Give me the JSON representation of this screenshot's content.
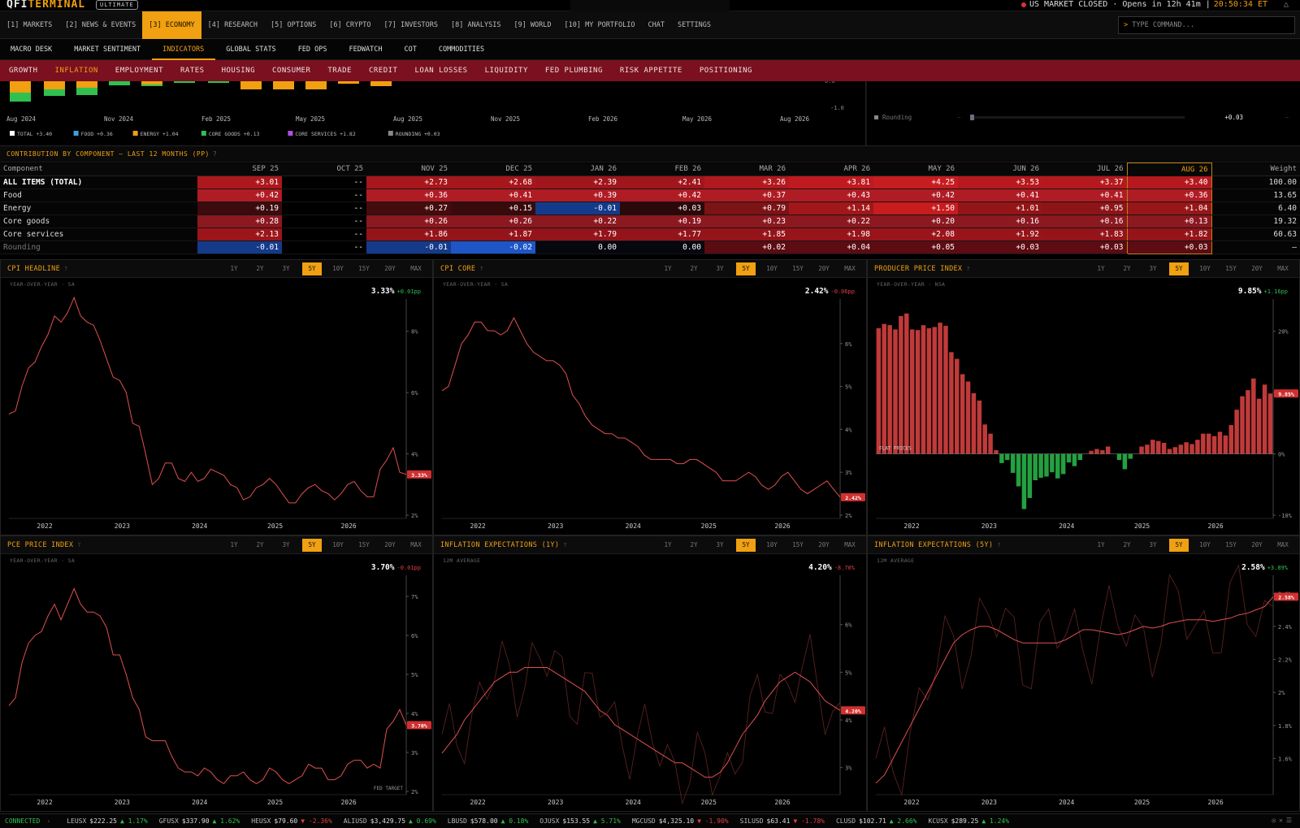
{
  "app": {
    "brand_a": "QFI",
    "brand_b": "TERMINAL",
    "badge": "ULTIMATE"
  },
  "market_status": {
    "text": "US MARKET CLOSED · Opens in 12h 41m |",
    "time": "20:50:34 ET"
  },
  "nav_main": [
    {
      "label": "[1] MARKETS",
      "active": false
    },
    {
      "label": "[2] NEWS & EVENTS",
      "active": false
    },
    {
      "label": "[3] ECONOMY",
      "active": true
    },
    {
      "label": "[4] RESEARCH",
      "active": false
    },
    {
      "label": "[5] OPTIONS",
      "active": false
    },
    {
      "label": "[6] CRYPTO",
      "active": false
    },
    {
      "label": "[7] INVESTORS",
      "active": false
    },
    {
      "label": "[8] ANALYSIS",
      "active": false
    },
    {
      "label": "[9] WORLD",
      "active": false
    },
    {
      "label": "[10] MY PORTFOLIO",
      "active": false
    },
    {
      "label": "CHAT",
      "active": false
    },
    {
      "label": "SETTINGS",
      "active": false
    }
  ],
  "command": {
    "prompt": ">",
    "placeholder": "TYPE COMMAND..."
  },
  "nav_sub": [
    {
      "label": "MACRO DESK",
      "active": false
    },
    {
      "label": "MARKET SENTIMENT",
      "active": false
    },
    {
      "label": "INDICATORS",
      "active": true
    },
    {
      "label": "GLOBAL STATS",
      "active": false
    },
    {
      "label": "FED OPS",
      "active": false
    },
    {
      "label": "FEDWATCH",
      "active": false
    },
    {
      "label": "COT",
      "active": false
    },
    {
      "label": "COMMODITIES",
      "active": false
    }
  ],
  "nav_cat": [
    {
      "label": "GROWTH",
      "active": false
    },
    {
      "label": "INFLATION",
      "active": true
    },
    {
      "label": "EMPLOYMENT",
      "active": false
    },
    {
      "label": "RATES",
      "active": false
    },
    {
      "label": "HOUSING",
      "active": false
    },
    {
      "label": "CONSUMER",
      "active": false
    },
    {
      "label": "TRADE",
      "active": false
    },
    {
      "label": "CREDIT",
      "active": false
    },
    {
      "label": "LOAN LOSSES",
      "active": false
    },
    {
      "label": "LIQUIDITY",
      "active": false
    },
    {
      "label": "FED PLUMBING",
      "active": false
    },
    {
      "label": "RISK APPETITE",
      "active": false
    },
    {
      "label": "POSITIONING",
      "active": false
    }
  ],
  "stack_chart": {
    "x_labels": [
      "Aug 2024",
      "Nov 2024",
      "Feb 2025",
      "May 2025",
      "Aug 2025",
      "Nov 2025",
      "Feb 2026",
      "May 2026",
      "Aug 2026"
    ],
    "y_labels": [
      "0.0",
      "-1.0"
    ],
    "legend": [
      {
        "label": "TOTAL +3.40",
        "color": "#ffffff"
      },
      {
        "label": "FOOD +0.36",
        "color": "#3aa0e0"
      },
      {
        "label": "ENERGY +1.04",
        "color": "#f0a010"
      },
      {
        "label": "CORE GOODS +0.13",
        "color": "#30c050"
      },
      {
        "label": "CORE SERVICES +1.82",
        "color": "#b050e0"
      },
      {
        "label": "ROUNDING +0.03",
        "color": "#888888"
      }
    ]
  },
  "right_mini": {
    "label": "Rounding",
    "dash": "—",
    "value": "+0.03",
    "dash2": "—"
  },
  "contrib": {
    "title": "CONTRIBUTION BY COMPONENT — LAST 12 MONTHS (PP)",
    "help": "?",
    "headers": [
      "Component",
      "SEP 25",
      "OCT 25",
      "NOV 25",
      "DEC 25",
      "JAN 26",
      "FEB 26",
      "MAR 26",
      "APR 26",
      "MAY 26",
      "JUN 26",
      "JUL 26",
      "AUG 26",
      "Weight"
    ],
    "rows": [
      {
        "name": "ALL ITEMS (TOTAL)",
        "vals": [
          "+3.01",
          "--",
          "+2.73",
          "+2.68",
          "+2.39",
          "+2.41",
          "+3.26",
          "+3.81",
          "+4.25",
          "+3.53",
          "+3.37",
          "+3.40"
        ],
        "weight": "100.00"
      },
      {
        "name": "Food",
        "vals": [
          "+0.42",
          "--",
          "+0.36",
          "+0.41",
          "+0.39",
          "+0.42",
          "+0.37",
          "+0.43",
          "+0.42",
          "+0.41",
          "+0.41",
          "+0.36"
        ],
        "weight": "13.65"
      },
      {
        "name": "Energy",
        "vals": [
          "+0.19",
          "--",
          "+0.27",
          "+0.15",
          "-0.01",
          "+0.03",
          "+0.79",
          "+1.14",
          "+1.50",
          "+1.01",
          "+0.95",
          "+1.04"
        ],
        "weight": "6.40"
      },
      {
        "name": "Core goods",
        "vals": [
          "+0.28",
          "--",
          "+0.26",
          "+0.26",
          "+0.22",
          "+0.19",
          "+0.23",
          "+0.22",
          "+0.20",
          "+0.16",
          "+0.16",
          "+0.13"
        ],
        "weight": "19.32"
      },
      {
        "name": "Core services",
        "vals": [
          "+2.13",
          "--",
          "+1.86",
          "+1.87",
          "+1.79",
          "+1.77",
          "+1.85",
          "+1.98",
          "+2.08",
          "+1.92",
          "+1.83",
          "+1.82"
        ],
        "weight": "60.63"
      },
      {
        "name": "Rounding",
        "vals": [
          "-0.01",
          "--",
          "-0.01",
          "-0.02",
          "0.00",
          "0.00",
          "+0.02",
          "+0.04",
          "+0.05",
          "+0.03",
          "+0.03",
          "+0.03"
        ],
        "weight": "—"
      }
    ]
  },
  "ranges": [
    "1Y",
    "2Y",
    "3Y",
    "5Y",
    "10Y",
    "15Y",
    "20Y",
    "MAX"
  ],
  "range_selected": "5Y",
  "panels": [
    {
      "id": "cpi-headline",
      "title": "CPI HEADLINE",
      "sub": "YEAR-OVER-YEAR · SA",
      "value": "3.33%",
      "change": "+0.01pp",
      "dir": "up",
      "tag": "3.33%"
    },
    {
      "id": "cpi-core",
      "title": "CPI CORE",
      "sub": "YEAR-OVER-YEAR · SA",
      "value": "2.42%",
      "change": "-0.06pp",
      "dir": "dn",
      "tag": "2.42%"
    },
    {
      "id": "ppi",
      "title": "PRODUCER PRICE INDEX",
      "sub": "YEAR-OVER-YEAR · NSA",
      "value": "9.85%",
      "change": "+1.16pp",
      "dir": "up",
      "tag": "9.85%",
      "annotation": "FLAT PRICES"
    },
    {
      "id": "pce",
      "title": "PCE PRICE INDEX",
      "sub": "YEAR-OVER-YEAR · SA",
      "value": "3.70%",
      "change": "-0.01pp",
      "dir": "dn",
      "tag": "3.70%",
      "annotation": "FED TARGET"
    },
    {
      "id": "ie1y",
      "title": "INFLATION EXPECTATIONS (1Y)",
      "sub": "12M AVERAGE",
      "value": "4.20%",
      "change": "-8.70%",
      "dir": "dn",
      "tag": "4.20%"
    },
    {
      "id": "ie5y",
      "title": "INFLATION EXPECTATIONS (5Y)",
      "sub": "12M AVERAGE",
      "value": "2.58%",
      "change": "+3.89%",
      "dir": "up",
      "tag": "2.58%"
    }
  ],
  "chart_data": [
    {
      "type": "line",
      "title": "CPI HEADLINE",
      "x": [
        "2022",
        "2023",
        "2024",
        "2025",
        "2026"
      ],
      "ylim": [
        2,
        9
      ],
      "yticks": [
        "8%",
        "6%",
        "4%",
        "2%"
      ],
      "values": [
        5.3,
        5.4,
        6.2,
        6.8,
        7.0,
        7.5,
        7.9,
        8.5,
        8.3,
        8.6,
        9.1,
        8.5,
        8.3,
        8.2,
        7.7,
        7.1,
        6.5,
        6.4,
        6.0,
        5.0,
        4.9,
        4.0,
        3.0,
        3.2,
        3.7,
        3.7,
        3.2,
        3.1,
        3.4,
        3.1,
        3.2,
        3.5,
        3.4,
        3.3,
        3.0,
        2.9,
        2.5,
        2.6,
        2.9,
        3.0,
        3.2,
        3.0,
        2.7,
        2.4,
        2.4,
        2.7,
        2.9,
        3.0,
        2.8,
        2.7,
        2.5,
        2.7,
        3.0,
        3.1,
        2.8,
        2.6,
        2.6,
        3.5,
        3.8,
        4.2,
        3.4,
        3.33
      ]
    },
    {
      "type": "line",
      "title": "CPI CORE",
      "x": [
        "2022",
        "2023",
        "2024",
        "2025",
        "2026"
      ],
      "ylim": [
        2,
        7
      ],
      "yticks": [
        "6%",
        "5%",
        "4%",
        "3%",
        "2%"
      ],
      "values": [
        4.9,
        5.0,
        5.5,
        6.0,
        6.2,
        6.5,
        6.5,
        6.3,
        6.3,
        6.2,
        6.3,
        6.6,
        6.3,
        6.0,
        5.8,
        5.7,
        5.6,
        5.6,
        5.5,
        5.3,
        4.8,
        4.6,
        4.3,
        4.1,
        4.0,
        3.9,
        3.9,
        3.8,
        3.8,
        3.7,
        3.6,
        3.4,
        3.3,
        3.3,
        3.3,
        3.3,
        3.2,
        3.2,
        3.3,
        3.3,
        3.2,
        3.1,
        3.0,
        2.8,
        2.8,
        2.8,
        2.9,
        3.0,
        2.9,
        2.7,
        2.6,
        2.7,
        2.9,
        3.0,
        2.8,
        2.6,
        2.5,
        2.6,
        2.7,
        2.8,
        2.6,
        2.42
      ]
    },
    {
      "type": "bar",
      "title": "PRODUCER PRICE INDEX",
      "x": [
        "2022",
        "2023",
        "2024",
        "2025",
        "2026"
      ],
      "ylim": [
        -10,
        25
      ],
      "yticks": [
        "20%",
        "10%",
        "0%",
        "-10%"
      ],
      "values": [
        20.5,
        21.2,
        21.0,
        20.3,
        22.5,
        22.9,
        20.3,
        20.2,
        21.0,
        20.5,
        20.7,
        21.4,
        20.9,
        16.6,
        15.5,
        13.0,
        11.8,
        9.9,
        8.7,
        4.8,
        3.3,
        0.6,
        -1.5,
        -1.0,
        -3.1,
        -5.3,
        -9.0,
        -7.2,
        -4.3,
        -3.9,
        -3.7,
        -3.0,
        -4.0,
        -3.3,
        -1.4,
        -2.0,
        -1.0,
        0,
        0.5,
        0.8,
        0.6,
        1.2,
        0,
        -1.0,
        -2.5,
        -0.8,
        0,
        1.2,
        1.5,
        2.3,
        2.1,
        1.8,
        0.8,
        1.1,
        1.5,
        1.9,
        1.6,
        2.3,
        3.3,
        3.3,
        2.9,
        3.6,
        3.0,
        4.7,
        7.2,
        9.4,
        10.4,
        12.3,
        9.0,
        11.3,
        9.85
      ]
    },
    {
      "type": "line",
      "title": "PCE PRICE INDEX",
      "x": [
        "2022",
        "2023",
        "2024",
        "2025",
        "2026"
      ],
      "ylim": [
        2,
        7.5
      ],
      "yticks": [
        "7%",
        "6%",
        "5%",
        "4%",
        "3%",
        "2%"
      ],
      "values": [
        4.2,
        4.4,
        5.3,
        5.8,
        6.0,
        6.1,
        6.5,
        6.8,
        6.4,
        6.8,
        7.2,
        6.8,
        6.6,
        6.6,
        6.5,
        6.2,
        5.5,
        5.5,
        5.0,
        4.4,
        4.1,
        3.4,
        3.3,
        3.3,
        3.3,
        2.9,
        2.6,
        2.5,
        2.5,
        2.4,
        2.6,
        2.5,
        2.3,
        2.2,
        2.4,
        2.4,
        2.5,
        2.3,
        2.2,
        2.3,
        2.6,
        2.5,
        2.3,
        2.2,
        2.3,
        2.4,
        2.7,
        2.6,
        2.6,
        2.3,
        2.3,
        2.4,
        2.7,
        2.8,
        2.8,
        2.6,
        2.7,
        2.6,
        3.6,
        3.8,
        4.1,
        3.7
      ]
    },
    {
      "type": "line",
      "title": "INFLATION EXPECTATIONS (1Y)",
      "x": [
        "2022",
        "2023",
        "2024",
        "2025",
        "2026"
      ],
      "ylim": [
        2.5,
        7
      ],
      "yticks": [
        "6%",
        "5%",
        "4%",
        "3%"
      ],
      "series": [
        {
          "name": "",
          "values": [
            3.3,
            3.5,
            3.7,
            4.0,
            4.2,
            4.4,
            4.6,
            4.8,
            4.9,
            5.0,
            5.0,
            5.1,
            5.1,
            5.1,
            5.1,
            5.0,
            4.9,
            4.8,
            4.7,
            4.6,
            4.4,
            4.2,
            4.1,
            3.9,
            3.8,
            3.7,
            3.6,
            3.5,
            3.4,
            3.3,
            3.2,
            3.1,
            3.1,
            3.0,
            2.9,
            2.8,
            2.8,
            2.9,
            3.1,
            3.4,
            3.7,
            3.9,
            4.1,
            4.4,
            4.6,
            4.8,
            4.9,
            5.0,
            4.9,
            4.8,
            4.6,
            4.4,
            4.3,
            4.2
          ]
        }
      ]
    },
    {
      "type": "line",
      "title": "INFLATION EXPECTATIONS (5Y)",
      "x": [
        "2022",
        "2023",
        "2024",
        "2025",
        "2026"
      ],
      "ylim": [
        1.4,
        2.7
      ],
      "yticks": [
        "2.6%",
        "2.4%",
        "2.2%",
        "2%",
        "1.8%",
        "1.6%"
      ],
      "series": [
        {
          "name": "",
          "values": [
            1.45,
            1.5,
            1.6,
            1.7,
            1.8,
            1.9,
            2.0,
            2.1,
            2.2,
            2.3,
            2.35,
            2.38,
            2.4,
            2.4,
            2.38,
            2.35,
            2.32,
            2.3,
            2.3,
            2.3,
            2.3,
            2.3,
            2.32,
            2.35,
            2.38,
            2.38,
            2.37,
            2.36,
            2.35,
            2.36,
            2.38,
            2.4,
            2.39,
            2.4,
            2.42,
            2.43,
            2.44,
            2.44,
            2.44,
            2.43,
            2.44,
            2.45,
            2.47,
            2.48,
            2.5,
            2.52,
            2.58
          ]
        }
      ]
    }
  ],
  "tickers": [
    {
      "sym": "LEUSX",
      "px": "$222.25",
      "chg": "▲ 1.17%",
      "dir": "up"
    },
    {
      "sym": "GFUSX",
      "px": "$337.90",
      "chg": "▲ 1.62%",
      "dir": "up"
    },
    {
      "sym": "HEUSX",
      "px": "$79.60",
      "chg": "▼ -2.36%",
      "dir": "dn"
    },
    {
      "sym": "ALIUSD",
      "px": "$3,429.75",
      "chg": "▲ 0.69%",
      "dir": "up"
    },
    {
      "sym": "LBUSD",
      "px": "$578.00",
      "chg": "▲ 0.18%",
      "dir": "up"
    },
    {
      "sym": "OJUSX",
      "px": "$153.55",
      "chg": "▲ 5.71%",
      "dir": "up"
    },
    {
      "sym": "MGCUSD",
      "px": "$4,325.10",
      "chg": "▼ -1.90%",
      "dir": "dn"
    },
    {
      "sym": "SILUSD",
      "px": "$63.41",
      "chg": "▼ -1.78%",
      "dir": "dn"
    },
    {
      "sym": "CLUSD",
      "px": "$102.71",
      "chg": "▲ 2.66%",
      "dir": "up"
    },
    {
      "sym": "KCUSX",
      "px": "$289.25",
      "chg": "▲ 1.24%",
      "dir": "up"
    }
  ],
  "status": {
    "connected": "CONNECTED"
  }
}
